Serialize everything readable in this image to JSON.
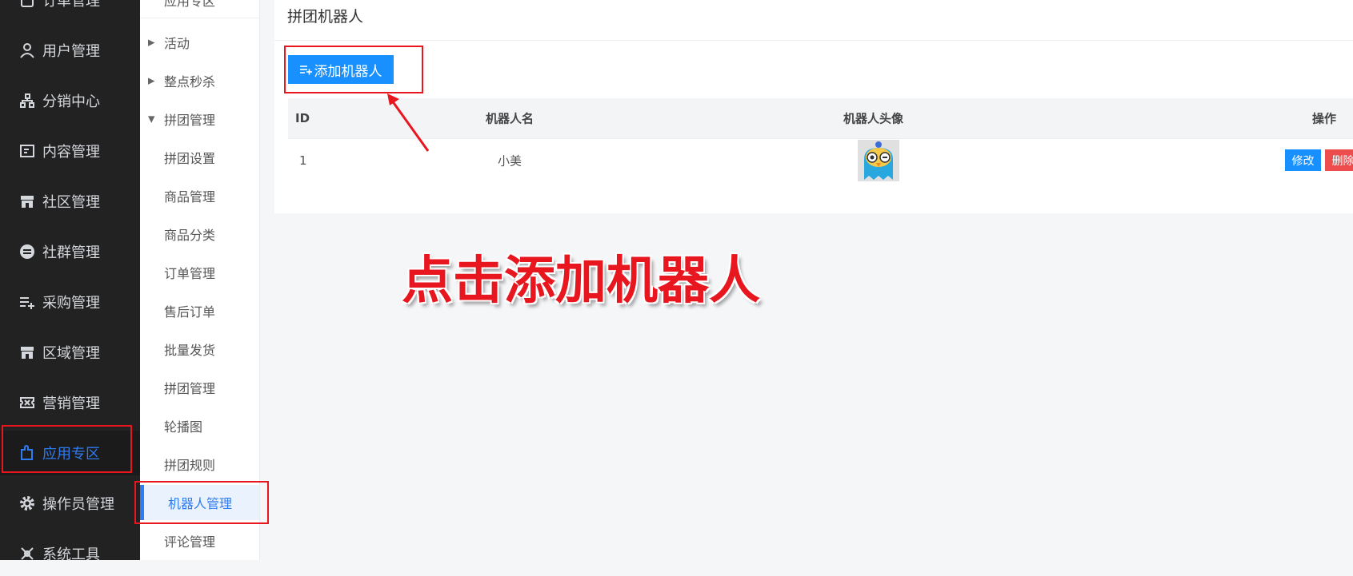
{
  "sidebar": {
    "items": [
      {
        "label": "订单管理",
        "icon": "order-icon"
      },
      {
        "label": "用户管理",
        "icon": "user-icon"
      },
      {
        "label": "分销中心",
        "icon": "hierarchy-icon"
      },
      {
        "label": "内容管理",
        "icon": "content-icon"
      },
      {
        "label": "社区管理",
        "icon": "store-icon"
      },
      {
        "label": "社群管理",
        "icon": "group-icon"
      },
      {
        "label": "采购管理",
        "icon": "list-add-icon"
      },
      {
        "label": "区域管理",
        "icon": "store-icon"
      },
      {
        "label": "营销管理",
        "icon": "ticket-icon"
      },
      {
        "label": "应用专区",
        "icon": "puzzle-icon",
        "active": true
      },
      {
        "label": "操作员管理",
        "icon": "gear-icon"
      },
      {
        "label": "系统工具",
        "icon": "tools-icon"
      }
    ]
  },
  "subnav": {
    "items": [
      {
        "label": "应用专区"
      },
      {
        "label": "活动",
        "caret": "collapsed"
      },
      {
        "label": "整点秒杀",
        "caret": "collapsed"
      },
      {
        "label": "拼团管理",
        "caret": "expanded"
      },
      {
        "label": "拼团设置"
      },
      {
        "label": "商品管理"
      },
      {
        "label": "商品分类"
      },
      {
        "label": "订单管理"
      },
      {
        "label": "售后订单"
      },
      {
        "label": "批量发货"
      },
      {
        "label": "拼团管理"
      },
      {
        "label": "轮播图"
      },
      {
        "label": "拼团规则"
      },
      {
        "label": "机器人管理",
        "active": true
      },
      {
        "label": "评论管理"
      }
    ]
  },
  "main": {
    "title": "拼团机器人",
    "add_button": "添加机器人",
    "table": {
      "headers": [
        "ID",
        "机器人名",
        "机器人头像",
        "操作"
      ],
      "rows": [
        {
          "id": "1",
          "name": "小美",
          "avatar": "parrot-avatar",
          "edit": "修改",
          "delete": "删除"
        }
      ]
    }
  },
  "annotation": {
    "text": "点击添加机器人",
    "color": "#e8161e"
  },
  "colors": {
    "primary": "#1890ff",
    "danger": "#ed4d4d",
    "sidebar_bg": "#222222",
    "active": "#2f7bf1"
  }
}
